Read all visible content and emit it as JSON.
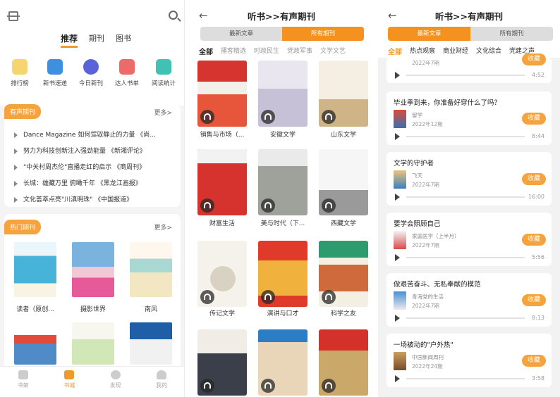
{
  "p1": {
    "tabs": [
      "推荐",
      "期刊",
      "图书"
    ],
    "quick": [
      "排行榜",
      "新书速递",
      "今日新刊",
      "达人书单",
      "阅读统计"
    ],
    "audio_section": {
      "title": "有声期刊",
      "more": "更多>"
    },
    "audio_items": [
      "Dance Magazine 如何驾驭静止的力量 《尚...",
      "努力为科技创新注入强劲能量 《新湘评论》",
      "\"中关村周杰伦\"直播走红的启示 《商周刊》",
      "长城：雄藏万里  俯瞰千年 《黑龙江画报》",
      "文化荟萃点亮\"川滇明珠\" 《中国报道》"
    ],
    "hot_section": {
      "title": "热门期刊",
      "more": "更多>"
    },
    "hot_items": [
      "读者（原创...",
      "摄影世界",
      "南风"
    ],
    "nav": [
      "书架",
      "书城",
      "发现",
      "我的"
    ]
  },
  "p2": {
    "title": "听书>>有声期刊",
    "seg": [
      "最新文章",
      "所有期刊"
    ],
    "cats": [
      "全部",
      "播客精选",
      "时政民生",
      "党政军事",
      "文学文艺"
    ],
    "covers": [
      "销售与市场（...",
      "安徽文学",
      "山东文学",
      "财富生活",
      "美与时代（下...",
      "西藏文学",
      "传记文学",
      "演讲与口才",
      "科学之友"
    ]
  },
  "p3": {
    "title": "听书>>有声期刊",
    "seg": [
      "最新文章",
      "所有期刊"
    ],
    "cats": [
      "全部",
      "热点观察",
      "商业财经",
      "文化综合",
      "党建之声"
    ],
    "collect": "收藏",
    "cards": [
      {
        "title": "",
        "author": "",
        "issue": "2022年7期",
        "dur": "4:52"
      },
      {
        "title": "毕业季到来，你准备好穿什么了吗？",
        "author": "留学",
        "issue": "2022年12期",
        "dur": "8:44"
      },
      {
        "title": "文学的守护者",
        "author": "飞天",
        "issue": "2022年7期",
        "dur": "16:00"
      },
      {
        "title": "要学会照顾自己",
        "author": "家庭医学（上半月）",
        "issue": "2022年7期",
        "dur": "5:56"
      },
      {
        "title": "做艰苦奋斗、无私奉献的模范",
        "author": "青海党的生活",
        "issue": "2022年7期",
        "dur": "8:13"
      },
      {
        "title": "一场被动的\"户外热\"",
        "author": "中国新闻周刊",
        "issue": "2022年24期",
        "dur": "3:58"
      }
    ]
  },
  "colors": {
    "accent": "#f4911f",
    "pill": "#f6a23d"
  }
}
